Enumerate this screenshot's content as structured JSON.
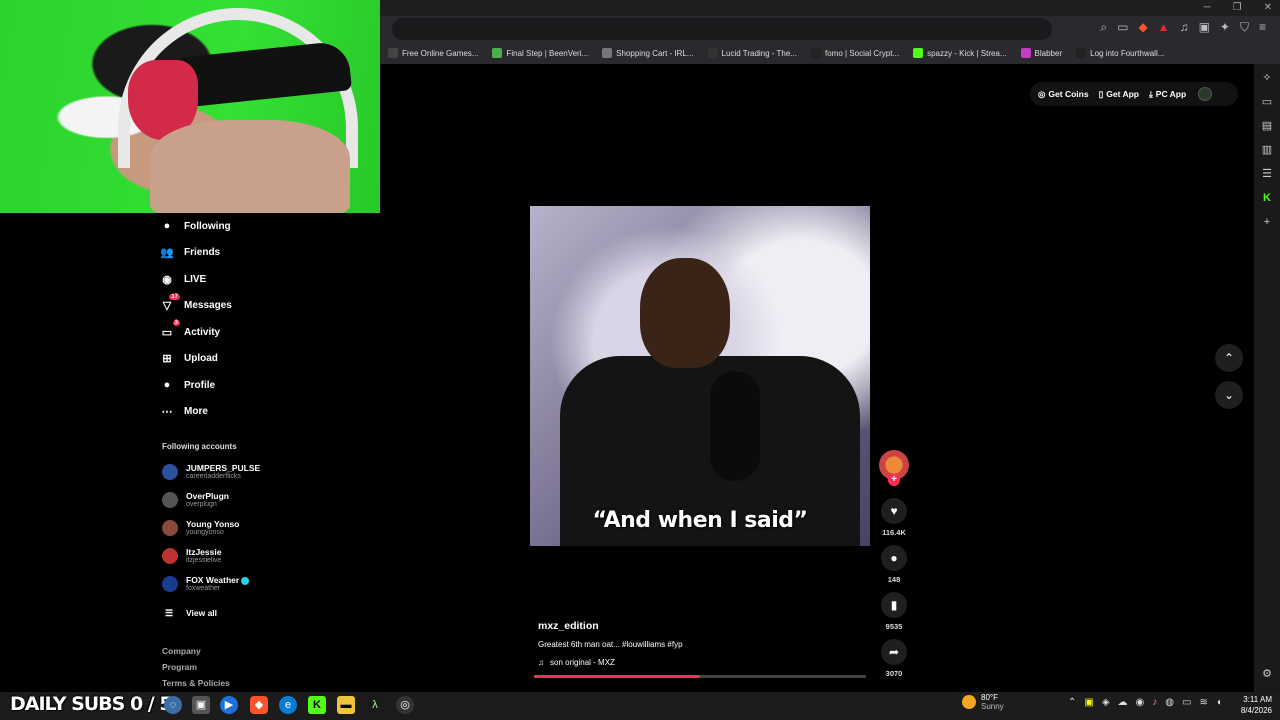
{
  "browser": {
    "bookmarks": [
      {
        "label": "Free Online Games...",
        "icon": "game-icon",
        "color": "#444"
      },
      {
        "label": "Final Step | BeenVeri...",
        "icon": "beenverified-icon",
        "color": "#4caf50"
      },
      {
        "label": "Shopping Cart - IRL...",
        "icon": "globe-icon",
        "color": "#777"
      },
      {
        "label": "Lucid Trading - The...",
        "icon": "lucid-icon",
        "color": "#333"
      },
      {
        "label": "fomo | Social Crypt...",
        "icon": "fomo-icon",
        "color": "#222"
      },
      {
        "label": "spazzy - Kick | Strea...",
        "icon": "kick-icon",
        "color": "#53fc18"
      },
      {
        "label": "Blabber",
        "icon": "blabber-icon",
        "color": "#c43ec4"
      },
      {
        "label": "Log into Fourthwall...",
        "icon": "fourthwall-icon",
        "color": "#222"
      }
    ]
  },
  "sidebar": {
    "items": [
      {
        "label": "Following",
        "icon": "following-avatar-icon"
      },
      {
        "label": "Friends",
        "icon": "friends-icon"
      },
      {
        "label": "LIVE",
        "icon": "live-icon"
      },
      {
        "label": "Messages",
        "icon": "messages-icon",
        "badge": "17"
      },
      {
        "label": "Activity",
        "icon": "activity-icon",
        "badge": "3"
      },
      {
        "label": "Upload",
        "icon": "upload-icon"
      },
      {
        "label": "Profile",
        "icon": "profile-icon"
      },
      {
        "label": "More",
        "icon": "more-icon"
      }
    ],
    "following_title": "Following accounts",
    "accounts": [
      {
        "name": "JUMPERS_PULSE",
        "handle": "careerladderflicks",
        "verified": false
      },
      {
        "name": "OverPlugn",
        "handle": "overplugn",
        "verified": false
      },
      {
        "name": "Young Yonso",
        "handle": "youngyonso",
        "verified": false
      },
      {
        "name": "ItzJessie",
        "handle": "itzjessielive",
        "verified": false
      },
      {
        "name": "FOX Weather",
        "handle": "foxweather",
        "verified": true
      }
    ],
    "view_all": "View all",
    "footer_links": [
      "Company",
      "Program",
      "Terms & Policies"
    ]
  },
  "top_pill": {
    "get_coins": "Get Coins",
    "get_app": "Get App",
    "pc_app": "PC App"
  },
  "video": {
    "caption": "“And when I said”",
    "author": "mxz_edition",
    "description": "Greatest 6th man oat... #louwilliams #fyp",
    "music": "son original - MXZ",
    "progress": 0.5
  },
  "actions": {
    "likes": "116.4K",
    "comments": "148",
    "saves": "9535",
    "shares": "3070"
  },
  "taskbar": {
    "subs_overlay": "DAILY SUBS 0 / 5",
    "weather_temp": "80°F",
    "weather_cond": "Sunny",
    "time": "3:11 AM",
    "date": "8/4/2026"
  },
  "colors": {
    "accent": "#fe2c55",
    "background": "#000000",
    "webcam_green": "#2bd32b"
  }
}
